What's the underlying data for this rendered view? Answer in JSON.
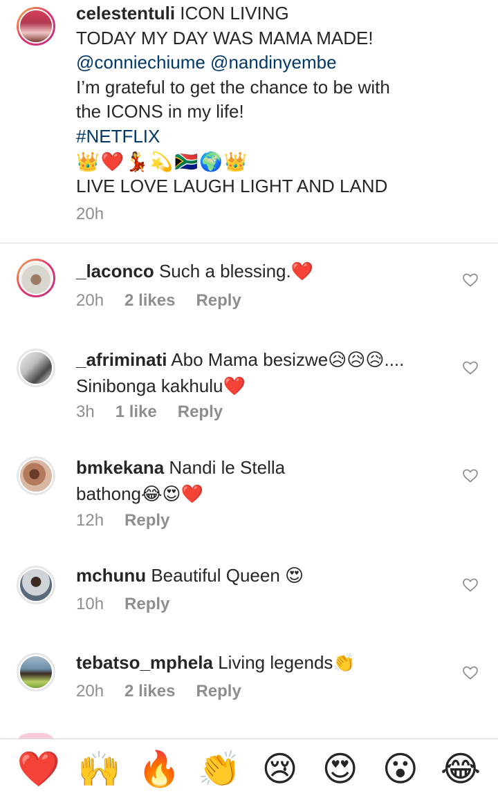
{
  "caption": {
    "username": "celestentuli",
    "lines": [
      "ICON LIVING",
      "TODAY MY DAY WAS MAMA MADE!"
    ],
    "mentions": "@conniechiume @nandinyembe",
    "line_grateful_1": "I’m grateful to get the chance to be with",
    "line_grateful_2": "the ICONS in my life!",
    "hashtag": "#NETFLIX",
    "emojis": [
      "👑",
      "❤️",
      "💃",
      "💫",
      "🇿🇦",
      "🌍",
      "👑"
    ],
    "line_last": "LIVE LOVE LAUGH LIGHT AND LAND",
    "time": "20h"
  },
  "comments": [
    {
      "username": "_laconco",
      "text": "Such a blessing.❤️",
      "time": "20h",
      "likes": "2 likes",
      "reply": "Reply"
    },
    {
      "username": "_afriminati",
      "text_1": "Abo Mama besizwe😥😥😥....",
      "text_2": "Sinibonga kakhulu❤️",
      "time": "3h",
      "likes": "1 like",
      "reply": "Reply"
    },
    {
      "username": "bmkekana",
      "text_1": "Nandi le Stella",
      "text_2": "bathong😂😍❤️",
      "time": "12h",
      "reply": "Reply"
    },
    {
      "username": "mchunu",
      "text": "Beautiful Queen 😍",
      "time": "10h",
      "reply": "Reply"
    },
    {
      "username": "tebatso_mphela",
      "text": "Living legends👏",
      "time": "20h",
      "likes": "2 likes",
      "reply": "Reply"
    }
  ],
  "reactions": [
    "❤️",
    "🙌",
    "🔥",
    "👏",
    "😢",
    "😍",
    "😮",
    "😂"
  ],
  "icons": {
    "like": "heart-outline-icon"
  },
  "colors": {
    "link": "#00376b",
    "secondary_text": "#8e8e8e",
    "divider": "#dbdbdb"
  }
}
